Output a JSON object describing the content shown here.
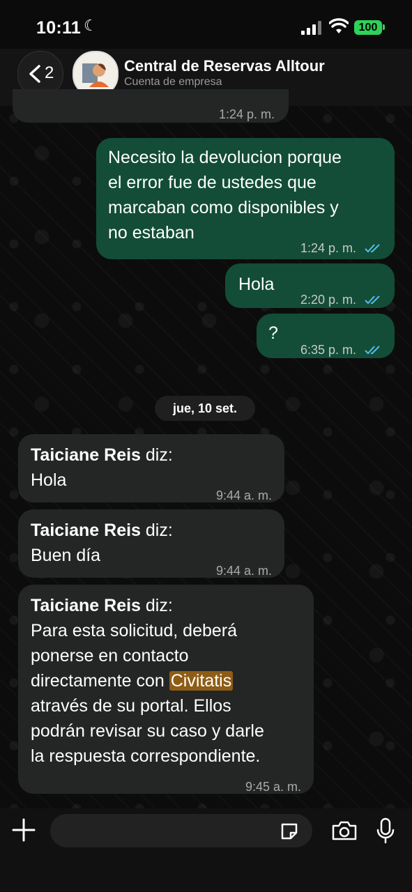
{
  "status": {
    "time": "10:11",
    "battery": "100"
  },
  "header": {
    "back_count": "2",
    "title": "Central de Reservas Alltour",
    "subtitle": "Cuenta de empresa"
  },
  "messages": {
    "partial_time": "1:24 p. m.",
    "out1": {
      "text": "Necesito la devolucion porque\nel error fue de ustedes que\nmarcaban como disponibles y\nno estaban",
      "time": "1:24 p. m."
    },
    "out2": {
      "text": "Hola",
      "time": "2:20 p. m."
    },
    "out3": {
      "text": "?",
      "time": "6:35 p. m."
    },
    "date_divider": "jue, 10 set.",
    "in1": {
      "sender": "Taiciane Reis",
      "suffix": " diz:",
      "text": "Hola",
      "time": "9:44 a. m."
    },
    "in2": {
      "sender": "Taiciane Reis",
      "suffix": " diz:",
      "text": "Buen día",
      "time": "9:44 a. m."
    },
    "in3": {
      "sender": "Taiciane Reis",
      "suffix": " diz:",
      "line1": "Para esta solicitud, deberá",
      "line2": "ponerse en contacto",
      "line3_before": "directamente con ",
      "line3_highlight": "Civitatis",
      "line4": "através de su portal. Ellos",
      "line5": "podrán revisar su caso y darle",
      "line6": "la respuesta correspondiente.",
      "time": "9:45 a. m."
    }
  },
  "input": {
    "placeholder": ""
  },
  "colors": {
    "outgoing": "#134d37",
    "incoming": "#242626",
    "read_ticks": "#53bdeb",
    "highlight": "#8e5c15"
  }
}
